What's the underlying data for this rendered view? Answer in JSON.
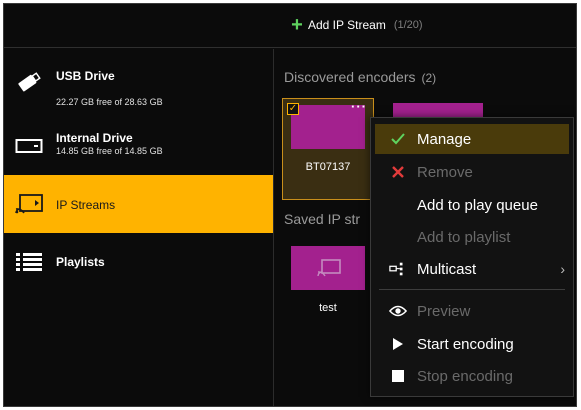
{
  "toolbar": {
    "add_stream_label": "Add IP Stream",
    "add_stream_count": "(1/20)"
  },
  "sidebar": {
    "items": [
      {
        "title": "USB Drive",
        "sub": "22.27 GB free of 28.63 GB",
        "icon": "usb-drive-icon"
      },
      {
        "title": "Internal Drive",
        "sub": "14.85 GB free of 14.85 GB",
        "icon": "internal-drive-icon"
      },
      {
        "title": "IP Streams",
        "icon": "ip-stream-icon",
        "active": true
      },
      {
        "title": "Playlists",
        "icon": "playlist-icon"
      }
    ]
  },
  "main": {
    "discovered": {
      "title": "Discovered encoders",
      "count": "(2)"
    },
    "saved": {
      "title": "Saved IP str"
    },
    "cards": [
      {
        "label": "BT07137",
        "selected": true
      },
      {
        "label": "",
        "selected": false
      },
      {
        "label": "test",
        "selected": false
      }
    ]
  },
  "context_menu": {
    "items": [
      {
        "label": "Manage",
        "icon": "check-icon",
        "enabled": true,
        "highlighted": true
      },
      {
        "label": "Remove",
        "icon": "remove-x-icon",
        "enabled": false
      },
      {
        "label": "Add to play queue",
        "icon": "",
        "enabled": true
      },
      {
        "label": "Add to playlist",
        "icon": "",
        "enabled": false
      },
      {
        "label": "Multicast",
        "icon": "multicast-icon",
        "enabled": true,
        "submenu": true
      },
      {
        "label": "Preview",
        "icon": "eye-icon",
        "enabled": false
      },
      {
        "label": "Start encoding",
        "icon": "play-icon",
        "enabled": true
      },
      {
        "label": "Stop encoding",
        "icon": "stop-icon",
        "enabled": false
      }
    ]
  },
  "colors": {
    "accent": "#ffb300",
    "thumb": "#a3218e",
    "background": "#0b0b0b",
    "check_green": "#5fd35f",
    "remove_red": "#e23b3b"
  }
}
